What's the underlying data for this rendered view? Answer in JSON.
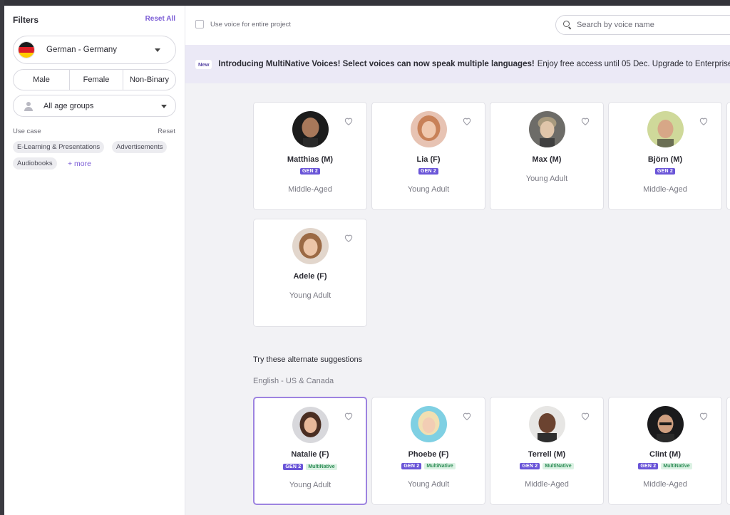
{
  "colors": {
    "accent": "#7b5cd6",
    "gen2_badge": "#6a55d8",
    "multinative_badge_text": "#2f8d57",
    "multinative_badge_bg": "#dcf2e4",
    "banner_bg": "#ebe9f6"
  },
  "sidebar": {
    "title": "Filters",
    "reset_all": "Reset All",
    "language": {
      "label": "German - Germany",
      "icon": "germany-flag-icon"
    },
    "gender_options": [
      "Male",
      "Female",
      "Non-Binary"
    ],
    "age": {
      "label": "All age groups",
      "icon": "person-icon"
    },
    "use_case": {
      "label": "Use case",
      "reset": "Reset",
      "chips": [
        "E-Learning & Presentations",
        "Advertisements",
        "Audiobooks"
      ],
      "more": "+ more"
    }
  },
  "topbar": {
    "checkbox_label": "Use voice for entire project",
    "search_placeholder": "Search by voice name"
  },
  "banner": {
    "badge": "New",
    "headline": "Introducing MultiNative Voices! Select voices can now speak multiple languages!",
    "body": "Enjoy free access until 05 Dec. Upgrade to Enterprise"
  },
  "voices": [
    {
      "name": "Matthias (M)",
      "badges": [
        "GEN 2"
      ],
      "age": "Middle-Aged"
    },
    {
      "name": "Lia (F)",
      "badges": [
        "GEN 2"
      ],
      "age": "Young Adult"
    },
    {
      "name": "Max (M)",
      "badges": [],
      "age": "Young Adult"
    },
    {
      "name": "Björn (M)",
      "badges": [
        "GEN 2"
      ],
      "age": "Middle-Aged"
    },
    {
      "name": "Adele (F)",
      "badges": [],
      "age": "Young Adult"
    }
  ],
  "suggestions": {
    "title": "Try these alternate suggestions",
    "language": "English - US & Canada",
    "voices": [
      {
        "name": "Natalie (F)",
        "badges": [
          "GEN 2",
          "MultiNative"
        ],
        "age": "Young Adult",
        "selected": true
      },
      {
        "name": "Phoebe (F)",
        "badges": [
          "GEN 2",
          "MultiNative"
        ],
        "age": "Young Adult",
        "selected": false
      },
      {
        "name": "Terrell (M)",
        "badges": [
          "GEN 2",
          "MultiNative"
        ],
        "age": "Middle-Aged",
        "selected": false
      },
      {
        "name": "Clint (M)",
        "badges": [
          "GEN 2",
          "MultiNative"
        ],
        "age": "Middle-Aged",
        "selected": false
      }
    ]
  }
}
